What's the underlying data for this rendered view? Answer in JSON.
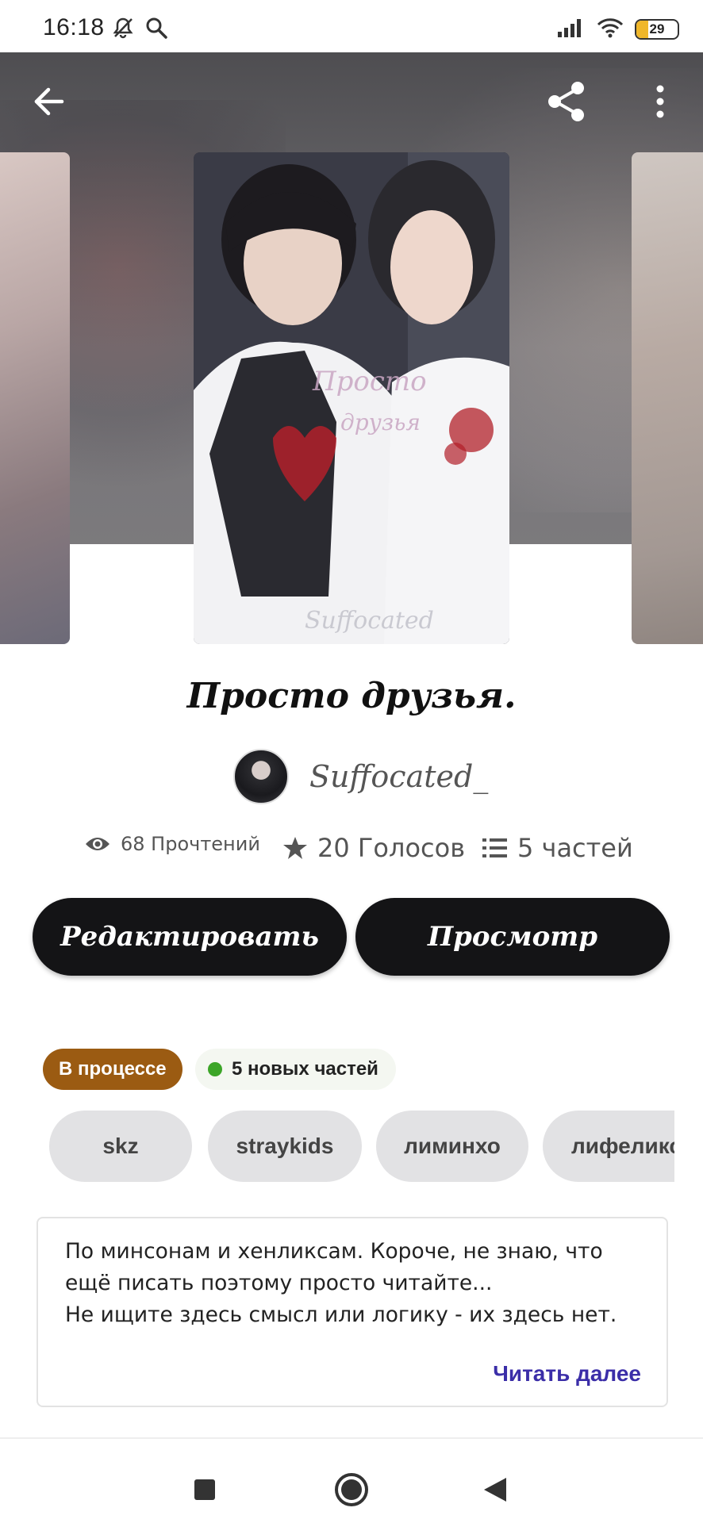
{
  "status_bar": {
    "time": "16:18",
    "battery": "29",
    "battery_level": 0.29,
    "icons": [
      "mute-bell-icon",
      "search-icon",
      "signal-icon",
      "wifi-icon",
      "battery-icon"
    ]
  },
  "colors": {
    "accent": "#3b2ea8",
    "status_chip": "#9b5b12",
    "dark_button": "#141416",
    "new_dot": "#3ca528",
    "tag_bg": "#e2e2e4"
  },
  "header": {
    "icons": [
      "back-arrow-icon",
      "share-icon",
      "more-vertical-icon"
    ]
  },
  "cover": {
    "watermark_1": "Просто",
    "watermark_2": "друзья",
    "watermark_3": "Suffocated"
  },
  "story": {
    "title": "Просто друзья.",
    "author": "Suffocated_"
  },
  "stats": {
    "reads": "68 Прочтений",
    "votes": "20 Голосов",
    "parts": "5 частей"
  },
  "actions": {
    "edit_label": "Редактировать",
    "view_label": "Просмотр"
  },
  "badges": {
    "status": "В процессе",
    "new_parts": "5 новых частей"
  },
  "tags": [
    "skz",
    "straykids",
    "лиминхо",
    "лифеликс"
  ],
  "description": {
    "line1": "По минсонам и хенликсам. Короче, не знаю, что",
    "line2": "ещё писать поэтому просто читайте...",
    "line3": "Не ищите здесь смысл или логику - их здесь нет.",
    "read_more": "Читать далее"
  },
  "nav": {
    "icons": [
      "recents-square-icon",
      "home-circle-icon",
      "back-triangle-icon"
    ]
  }
}
